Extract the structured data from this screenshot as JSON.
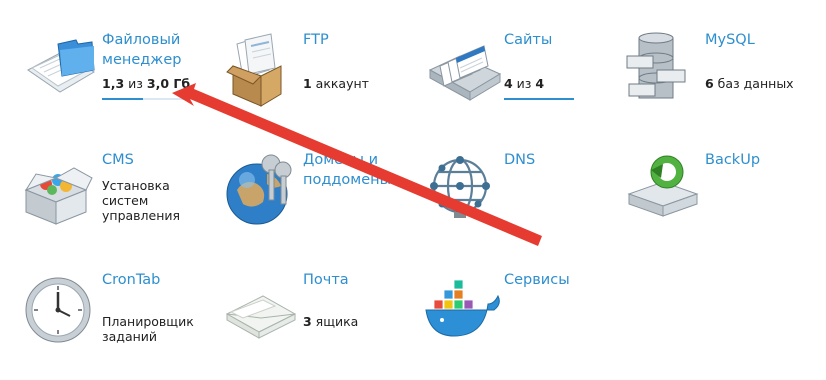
{
  "tiles": [
    {
      "key": "file-manager",
      "title": "Файловый менеджер",
      "info_bold_a": "1,3",
      "info_mid": " из ",
      "info_bold_b": "3,0 Гб",
      "progress": 0.43
    },
    {
      "key": "ftp",
      "title": "FTP",
      "info_bold": "1",
      "info_rest": " аккаунт"
    },
    {
      "key": "sites",
      "title": "Сайты",
      "info_bold_a": "4",
      "info_mid": " из ",
      "info_bold_b": "4",
      "progress": 1.0
    },
    {
      "key": "mysql",
      "title": "MySQL",
      "info_bold": "6",
      "info_rest": " баз данных"
    },
    {
      "key": "cms",
      "title": "CMS",
      "info_text": "Установка систем управления"
    },
    {
      "key": "domains",
      "title": "Домены и поддомены"
    },
    {
      "key": "dns",
      "title": "DNS"
    },
    {
      "key": "backup",
      "title": "BackUp"
    },
    {
      "key": "crontab",
      "title": "CronTab",
      "info_text": "Планировщик заданий"
    },
    {
      "key": "mail",
      "title": "Почта",
      "info_bold": "3",
      "info_rest": " ящика"
    },
    {
      "key": "services",
      "title": "Сервисы"
    }
  ],
  "colors": {
    "link": "#2e8fcf",
    "arrow": "#e53b30",
    "bar_bg": "#d9e8f3"
  },
  "icons": [
    "folder-documents-icon",
    "ftp-box-icon",
    "sites-pages-icon",
    "database-icon",
    "cms-box-icon",
    "globe-keys-icon",
    "network-globe-icon",
    "backup-drive-icon",
    "clock-icon",
    "envelope-icon",
    "docker-whale-icon"
  ]
}
